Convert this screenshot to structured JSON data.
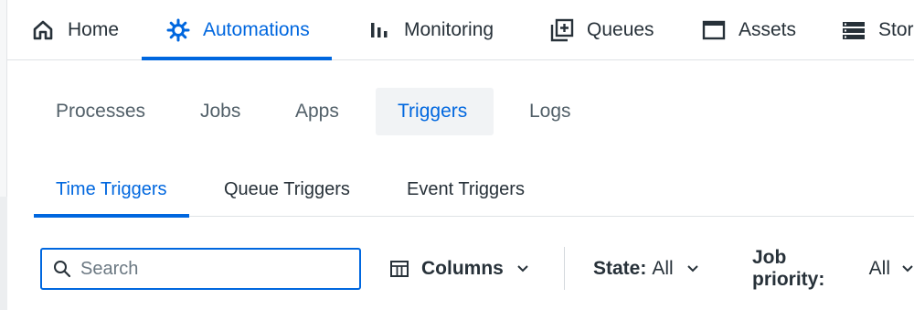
{
  "topnav": {
    "items": [
      {
        "label": "Home",
        "icon": "home-icon"
      },
      {
        "label": "Automations",
        "icon": "automations-icon",
        "active": true
      },
      {
        "label": "Monitoring",
        "icon": "monitoring-bars-icon"
      },
      {
        "label": "Queues",
        "icon": "queue-add-icon"
      },
      {
        "label": "Assets",
        "icon": "asset-window-icon"
      },
      {
        "label": "Stor",
        "icon": "storage-list-icon"
      }
    ]
  },
  "subtabs": [
    {
      "label": "Processes"
    },
    {
      "label": "Jobs"
    },
    {
      "label": "Apps"
    },
    {
      "label": "Triggers",
      "active": true
    },
    {
      "label": "Logs"
    }
  ],
  "trigger_tabs": [
    {
      "label": "Time Triggers",
      "active": true
    },
    {
      "label": "Queue Triggers"
    },
    {
      "label": "Event Triggers"
    }
  ],
  "toolbar": {
    "search_placeholder": "Search",
    "columns_label": "Columns",
    "state_label": "State:",
    "state_value": "All",
    "priority_label": "Job priority:",
    "priority_value": "All"
  },
  "colors": {
    "accent": "#0067df",
    "text": "#273139",
    "muted": "#526069"
  }
}
